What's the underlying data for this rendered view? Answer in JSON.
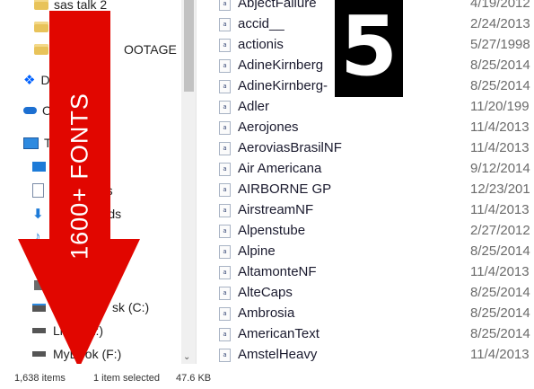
{
  "nav": {
    "items": [
      {
        "icon": "folder-icon",
        "label": "sas talk 2"
      },
      {
        "icon": "folder-icon",
        "label": "OOTAGE"
      },
      {
        "icon": "dropbox-icon",
        "label": "D"
      },
      {
        "icon": "onedrive-icon",
        "label": "O"
      },
      {
        "icon": "this-pc-icon",
        "label": "T"
      },
      {
        "icon": "desktop-icon",
        "label": ""
      },
      {
        "icon": "documents-icon",
        "label": "nts"
      },
      {
        "icon": "downloads-icon",
        "label": "ads"
      },
      {
        "icon": "music-icon",
        "label": "M"
      },
      {
        "icon": "pictures-icon",
        "label": ""
      },
      {
        "icon": "drive-icon",
        "label": "sk (C:)"
      },
      {
        "icon": "drive-icon",
        "label": "Li  es (E:)"
      },
      {
        "icon": "drive-icon",
        "label": "MyBook (F:)"
      }
    ]
  },
  "files": [
    {
      "name": "AbjectFailure",
      "date": "4/19/2012"
    },
    {
      "name": "accid__",
      "date": "2/24/2013"
    },
    {
      "name": "actionis",
      "date": "5/27/1998"
    },
    {
      "name": "AdineKirnberg",
      "date": "8/25/2014"
    },
    {
      "name": "AdineKirnberg-",
      "date": "8/25/2014"
    },
    {
      "name": "Adler",
      "date": "11/20/199"
    },
    {
      "name": "Aerojones",
      "date": "11/4/2013"
    },
    {
      "name": "AeroviasBrasilNF",
      "date": "11/4/2013"
    },
    {
      "name": "Air Americana",
      "date": "9/12/2014"
    },
    {
      "name": "AIRBORNE GP",
      "date": "12/23/201"
    },
    {
      "name": "AirstreamNF",
      "date": "11/4/2013"
    },
    {
      "name": "Alpenstube",
      "date": "2/27/2012"
    },
    {
      "name": "Alpine",
      "date": "8/25/2014"
    },
    {
      "name": "AltamonteNF",
      "date": "11/4/2013"
    },
    {
      "name": "AlteCaps",
      "date": "8/25/2014"
    },
    {
      "name": "Ambrosia",
      "date": "8/25/2014"
    },
    {
      "name": "AmericanText",
      "date": "8/25/2014"
    },
    {
      "name": "AmstelHeavy",
      "date": "11/4/2013"
    }
  ],
  "status": {
    "count": "1,638 items",
    "selected": "1 item selected",
    "size": "47.6 KB"
  },
  "overlay": {
    "number": "5",
    "banner": "1600+ FONTS",
    "arrow_color": "#e10600"
  }
}
